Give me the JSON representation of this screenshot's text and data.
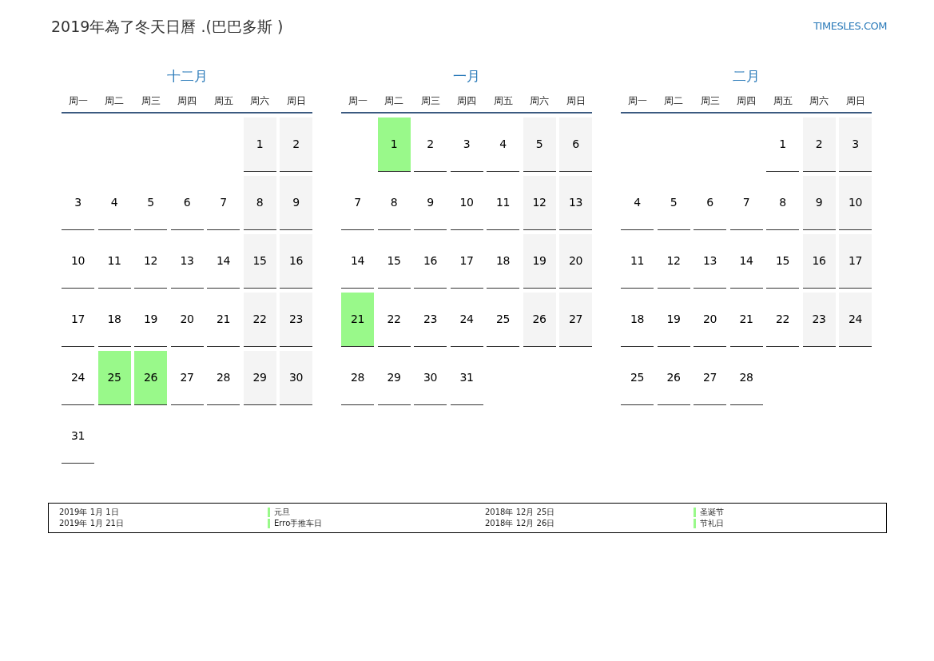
{
  "title": "2019年為了冬天日曆 .(巴巴多斯 )",
  "site_link": "TIMESLES.COM",
  "months": [
    {
      "name": "十二月",
      "weekdays": [
        "周一",
        "周二",
        "周三",
        "周四",
        "周五",
        "周六",
        "周日"
      ],
      "weeks": [
        [
          {
            "kind": "blank"
          },
          {
            "kind": "blank"
          },
          {
            "kind": "blank"
          },
          {
            "kind": "blank"
          },
          {
            "kind": "blank"
          },
          {
            "kind": "day",
            "day": "1",
            "holiday": false
          },
          {
            "kind": "day",
            "day": "2",
            "holiday": false
          }
        ],
        [
          {
            "kind": "day",
            "day": "3",
            "holiday": false
          },
          {
            "kind": "day",
            "day": "4",
            "holiday": false
          },
          {
            "kind": "day",
            "day": "5",
            "holiday": false
          },
          {
            "kind": "day",
            "day": "6",
            "holiday": false
          },
          {
            "kind": "day",
            "day": "7",
            "holiday": false
          },
          {
            "kind": "day",
            "day": "8",
            "holiday": false
          },
          {
            "kind": "day",
            "day": "9",
            "holiday": false
          }
        ],
        [
          {
            "kind": "day",
            "day": "10",
            "holiday": false
          },
          {
            "kind": "day",
            "day": "11",
            "holiday": false
          },
          {
            "kind": "day",
            "day": "12",
            "holiday": false
          },
          {
            "kind": "day",
            "day": "13",
            "holiday": false
          },
          {
            "kind": "day",
            "day": "14",
            "holiday": false
          },
          {
            "kind": "day",
            "day": "15",
            "holiday": false
          },
          {
            "kind": "day",
            "day": "16",
            "holiday": false
          }
        ],
        [
          {
            "kind": "day",
            "day": "17",
            "holiday": false
          },
          {
            "kind": "day",
            "day": "18",
            "holiday": false
          },
          {
            "kind": "day",
            "day": "19",
            "holiday": false
          },
          {
            "kind": "day",
            "day": "20",
            "holiday": false
          },
          {
            "kind": "day",
            "day": "21",
            "holiday": false
          },
          {
            "kind": "day",
            "day": "22",
            "holiday": false
          },
          {
            "kind": "day",
            "day": "23",
            "holiday": false
          }
        ],
        [
          {
            "kind": "day",
            "day": "24",
            "holiday": false
          },
          {
            "kind": "day",
            "day": "25",
            "holiday": true
          },
          {
            "kind": "day",
            "day": "26",
            "holiday": true
          },
          {
            "kind": "day",
            "day": "27",
            "holiday": false
          },
          {
            "kind": "day",
            "day": "28",
            "holiday": false
          },
          {
            "kind": "day",
            "day": "29",
            "holiday": false
          },
          {
            "kind": "day",
            "day": "30",
            "holiday": false
          }
        ],
        [
          {
            "kind": "day",
            "day": "31",
            "holiday": false
          }
        ]
      ]
    },
    {
      "name": "一月",
      "weekdays": [
        "周一",
        "周二",
        "周三",
        "周四",
        "周五",
        "周六",
        "周日"
      ],
      "weeks": [
        [
          {
            "kind": "blank"
          },
          {
            "kind": "day",
            "day": "1",
            "holiday": true
          },
          {
            "kind": "day",
            "day": "2",
            "holiday": false
          },
          {
            "kind": "day",
            "day": "3",
            "holiday": false
          },
          {
            "kind": "day",
            "day": "4",
            "holiday": false
          },
          {
            "kind": "day",
            "day": "5",
            "holiday": false
          },
          {
            "kind": "day",
            "day": "6",
            "holiday": false
          }
        ],
        [
          {
            "kind": "day",
            "day": "7",
            "holiday": false
          },
          {
            "kind": "day",
            "day": "8",
            "holiday": false
          },
          {
            "kind": "day",
            "day": "9",
            "holiday": false
          },
          {
            "kind": "day",
            "day": "10",
            "holiday": false
          },
          {
            "kind": "day",
            "day": "11",
            "holiday": false
          },
          {
            "kind": "day",
            "day": "12",
            "holiday": false
          },
          {
            "kind": "day",
            "day": "13",
            "holiday": false
          }
        ],
        [
          {
            "kind": "day",
            "day": "14",
            "holiday": false
          },
          {
            "kind": "day",
            "day": "15",
            "holiday": false
          },
          {
            "kind": "day",
            "day": "16",
            "holiday": false
          },
          {
            "kind": "day",
            "day": "17",
            "holiday": false
          },
          {
            "kind": "day",
            "day": "18",
            "holiday": false
          },
          {
            "kind": "day",
            "day": "19",
            "holiday": false
          },
          {
            "kind": "day",
            "day": "20",
            "holiday": false
          }
        ],
        [
          {
            "kind": "day",
            "day": "21",
            "holiday": true
          },
          {
            "kind": "day",
            "day": "22",
            "holiday": false
          },
          {
            "kind": "day",
            "day": "23",
            "holiday": false
          },
          {
            "kind": "day",
            "day": "24",
            "holiday": false
          },
          {
            "kind": "day",
            "day": "25",
            "holiday": false
          },
          {
            "kind": "day",
            "day": "26",
            "holiday": false
          },
          {
            "kind": "day",
            "day": "27",
            "holiday": false
          }
        ],
        [
          {
            "kind": "day",
            "day": "28",
            "holiday": false
          },
          {
            "kind": "day",
            "day": "29",
            "holiday": false
          },
          {
            "kind": "day",
            "day": "30",
            "holiday": false
          },
          {
            "kind": "day",
            "day": "31",
            "holiday": false
          }
        ]
      ]
    },
    {
      "name": "二月",
      "weekdays": [
        "周一",
        "周二",
        "周三",
        "周四",
        "周五",
        "周六",
        "周日"
      ],
      "weeks": [
        [
          {
            "kind": "blank"
          },
          {
            "kind": "blank"
          },
          {
            "kind": "blank"
          },
          {
            "kind": "blank"
          },
          {
            "kind": "day",
            "day": "1",
            "holiday": false
          },
          {
            "kind": "day",
            "day": "2",
            "holiday": false
          },
          {
            "kind": "day",
            "day": "3",
            "holiday": false
          }
        ],
        [
          {
            "kind": "day",
            "day": "4",
            "holiday": false
          },
          {
            "kind": "day",
            "day": "5",
            "holiday": false
          },
          {
            "kind": "day",
            "day": "6",
            "holiday": false
          },
          {
            "kind": "day",
            "day": "7",
            "holiday": false
          },
          {
            "kind": "day",
            "day": "8",
            "holiday": false
          },
          {
            "kind": "day",
            "day": "9",
            "holiday": false
          },
          {
            "kind": "day",
            "day": "10",
            "holiday": false
          }
        ],
        [
          {
            "kind": "day",
            "day": "11",
            "holiday": false
          },
          {
            "kind": "day",
            "day": "12",
            "holiday": false
          },
          {
            "kind": "day",
            "day": "13",
            "holiday": false
          },
          {
            "kind": "day",
            "day": "14",
            "holiday": false
          },
          {
            "kind": "day",
            "day": "15",
            "holiday": false
          },
          {
            "kind": "day",
            "day": "16",
            "holiday": false
          },
          {
            "kind": "day",
            "day": "17",
            "holiday": false
          }
        ],
        [
          {
            "kind": "day",
            "day": "18",
            "holiday": false
          },
          {
            "kind": "day",
            "day": "19",
            "holiday": false
          },
          {
            "kind": "day",
            "day": "20",
            "holiday": false
          },
          {
            "kind": "day",
            "day": "21",
            "holiday": false
          },
          {
            "kind": "day",
            "day": "22",
            "holiday": false
          },
          {
            "kind": "day",
            "day": "23",
            "holiday": false
          },
          {
            "kind": "day",
            "day": "24",
            "holiday": false
          }
        ],
        [
          {
            "kind": "day",
            "day": "25",
            "holiday": false
          },
          {
            "kind": "day",
            "day": "26",
            "holiday": false
          },
          {
            "kind": "day",
            "day": "27",
            "holiday": false
          },
          {
            "kind": "day",
            "day": "28",
            "holiday": false
          }
        ]
      ]
    }
  ],
  "legend": {
    "columns": [
      {
        "entries": [
          {
            "date": "2019年 1月 1日",
            "name": "元旦",
            "color": "#99f98a"
          },
          {
            "date": "2019年 1月 21日",
            "name": "Erro手推车日",
            "color": "#99f98a"
          }
        ]
      },
      {
        "entries": [
          {
            "date": "2018年 12月 25日",
            "name": "圣诞节",
            "color": "#99f98a"
          },
          {
            "date": "2018年 12月 26日",
            "name": "节礼日",
            "color": "#99f98a"
          }
        ]
      }
    ]
  }
}
